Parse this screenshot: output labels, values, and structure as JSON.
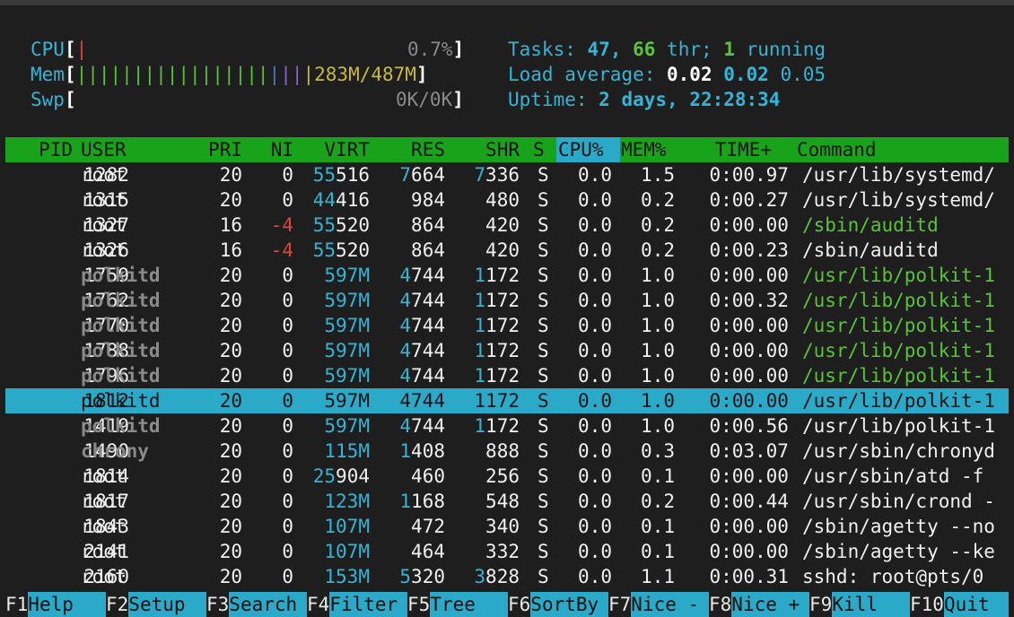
{
  "meters": {
    "cpu": {
      "label": "CPU",
      "bar": "|",
      "value": "0.7%"
    },
    "mem": {
      "label": "Mem",
      "bar_green": "|||||||||||||||||",
      "bar_blue": "|",
      "bar_purple": "||",
      "bar_yellow": "|",
      "value": "283M/487M"
    },
    "swp": {
      "label": "Swp",
      "value": "0K/0K"
    }
  },
  "summary": {
    "tasks_label": "Tasks: ",
    "tasks": "47",
    "sep1": ", ",
    "thr": "66",
    "thr_label": " thr; ",
    "running": "1",
    "running_label": " running",
    "load_label": "Load average: ",
    "load1": "0.02",
    "load5": "0.02",
    "load15": "0.05",
    "uptime_label": "Uptime: ",
    "uptime": "2 days, 22:28:34"
  },
  "columns": [
    "PID",
    "USER",
    "PRI",
    "NI",
    "VIRT",
    "RES",
    "SHR",
    "S",
    "CPU%",
    "MEM%",
    "TIME+",
    "Command"
  ],
  "processes": [
    {
      "pid": "1282",
      "user": "root",
      "pri": "20",
      "ni": "0",
      "virt_hi": "55",
      "virt_lo": "516",
      "res_hi": "7",
      "res_lo": "664",
      "shr_hi": "7",
      "shr_lo": "336",
      "s": "S",
      "cpu": "0.0",
      "mem": "1.5",
      "time": "0:00.97",
      "cmd": "/usr/lib/systemd/"
    },
    {
      "pid": "1315",
      "user": "root",
      "pri": "20",
      "ni": "0",
      "virt_hi": "44",
      "virt_lo": "416",
      "res_hi": "",
      "res_lo": "984",
      "shr_hi": "",
      "shr_lo": "480",
      "s": "S",
      "cpu": "0.0",
      "mem": "0.2",
      "time": "0:00.27",
      "cmd": "/usr/lib/systemd/"
    },
    {
      "pid": "1327",
      "user": "root",
      "pri": "16",
      "ni": "-4",
      "virt_hi": "55",
      "virt_lo": "520",
      "res_hi": "",
      "res_lo": "864",
      "shr_hi": "",
      "shr_lo": "420",
      "s": "S",
      "cpu": "0.0",
      "mem": "0.2",
      "time": "0:00.00",
      "cmd": "/sbin/auditd"
    },
    {
      "pid": "1326",
      "user": "root",
      "pri": "16",
      "ni": "-4",
      "virt_hi": "55",
      "virt_lo": "520",
      "res_hi": "",
      "res_lo": "864",
      "shr_hi": "",
      "shr_lo": "420",
      "s": "S",
      "cpu": "0.0",
      "mem": "0.2",
      "time": "0:00.23",
      "cmd": "/sbin/auditd"
    },
    {
      "pid": "1759",
      "user": "polkitd",
      "pri": "20",
      "ni": "0",
      "virt_hi": "",
      "virt_lo": "597M",
      "res_hi": "4",
      "res_lo": "744",
      "shr_hi": "1",
      "shr_lo": "172",
      "s": "S",
      "cpu": "0.0",
      "mem": "1.0",
      "time": "0:00.00",
      "cmd": "/usr/lib/polkit-1"
    },
    {
      "pid": "1762",
      "user": "polkitd",
      "pri": "20",
      "ni": "0",
      "virt_hi": "",
      "virt_lo": "597M",
      "res_hi": "4",
      "res_lo": "744",
      "shr_hi": "1",
      "shr_lo": "172",
      "s": "S",
      "cpu": "0.0",
      "mem": "1.0",
      "time": "0:00.32",
      "cmd": "/usr/lib/polkit-1"
    },
    {
      "pid": "1770",
      "user": "polkitd",
      "pri": "20",
      "ni": "0",
      "virt_hi": "",
      "virt_lo": "597M",
      "res_hi": "4",
      "res_lo": "744",
      "shr_hi": "1",
      "shr_lo": "172",
      "s": "S",
      "cpu": "0.0",
      "mem": "1.0",
      "time": "0:00.00",
      "cmd": "/usr/lib/polkit-1"
    },
    {
      "pid": "1788",
      "user": "polkitd",
      "pri": "20",
      "ni": "0",
      "virt_hi": "",
      "virt_lo": "597M",
      "res_hi": "4",
      "res_lo": "744",
      "shr_hi": "1",
      "shr_lo": "172",
      "s": "S",
      "cpu": "0.0",
      "mem": "1.0",
      "time": "0:00.00",
      "cmd": "/usr/lib/polkit-1"
    },
    {
      "pid": "1796",
      "user": "polkitd",
      "pri": "20",
      "ni": "0",
      "virt_hi": "",
      "virt_lo": "597M",
      "res_hi": "4",
      "res_lo": "744",
      "shr_hi": "1",
      "shr_lo": "172",
      "s": "S",
      "cpu": "0.0",
      "mem": "1.0",
      "time": "0:00.00",
      "cmd": "/usr/lib/polkit-1"
    },
    {
      "pid": "1812",
      "user": "polkitd",
      "pri": "20",
      "ni": "0",
      "virt_hi": "",
      "virt_lo": "597M",
      "res_hi": "",
      "res_lo": "4744",
      "shr_hi": "",
      "shr_lo": "1172",
      "s": "S",
      "cpu": "0.0",
      "mem": "1.0",
      "time": "0:00.00",
      "cmd": "/usr/lib/polkit-1",
      "selected": true
    },
    {
      "pid": "1419",
      "user": "polkitd",
      "pri": "20",
      "ni": "0",
      "virt_hi": "",
      "virt_lo": "597M",
      "res_hi": "4",
      "res_lo": "744",
      "shr_hi": "1",
      "shr_lo": "172",
      "s": "S",
      "cpu": "0.0",
      "mem": "1.0",
      "time": "0:00.56",
      "cmd": "/usr/lib/polkit-1"
    },
    {
      "pid": "1490",
      "user": "chrony",
      "pri": "20",
      "ni": "0",
      "virt_hi": "",
      "virt_lo": "115M",
      "res_hi": "1",
      "res_lo": "408",
      "shr_hi": "",
      "shr_lo": "888",
      "s": "S",
      "cpu": "0.0",
      "mem": "0.3",
      "time": "0:03.07",
      "cmd": "/usr/sbin/chronyd"
    },
    {
      "pid": "1814",
      "user": "root",
      "pri": "20",
      "ni": "0",
      "virt_hi": "25",
      "virt_lo": "904",
      "res_hi": "",
      "res_lo": "460",
      "shr_hi": "",
      "shr_lo": "256",
      "s": "S",
      "cpu": "0.0",
      "mem": "0.1",
      "time": "0:00.00",
      "cmd": "/usr/sbin/atd -f"
    },
    {
      "pid": "1817",
      "user": "root",
      "pri": "20",
      "ni": "0",
      "virt_hi": "",
      "virt_lo": "123M",
      "res_hi": "1",
      "res_lo": "168",
      "shr_hi": "",
      "shr_lo": "548",
      "s": "S",
      "cpu": "0.0",
      "mem": "0.2",
      "time": "0:00.44",
      "cmd": "/usr/sbin/crond -"
    },
    {
      "pid": "1843",
      "user": "root",
      "pri": "20",
      "ni": "0",
      "virt_hi": "",
      "virt_lo": "107M",
      "res_hi": "",
      "res_lo": "472",
      "shr_hi": "",
      "shr_lo": "340",
      "s": "S",
      "cpu": "0.0",
      "mem": "0.1",
      "time": "0:00.00",
      "cmd": "/sbin/agetty --no"
    },
    {
      "pid": "2141",
      "user": "root",
      "pri": "20",
      "ni": "0",
      "virt_hi": "",
      "virt_lo": "107M",
      "res_hi": "",
      "res_lo": "464",
      "shr_hi": "",
      "shr_lo": "332",
      "s": "S",
      "cpu": "0.0",
      "mem": "0.1",
      "time": "0:00.00",
      "cmd": "/sbin/agetty --ke"
    },
    {
      "pid": "2160",
      "user": "root",
      "pri": "20",
      "ni": "0",
      "virt_hi": "",
      "virt_lo": "153M",
      "res_hi": "5",
      "res_lo": "320",
      "shr_hi": "3",
      "shr_lo": "828",
      "s": "S",
      "cpu": "0.0",
      "mem": "1.1",
      "time": "0:00.31",
      "cmd": "sshd: root@pts/0"
    }
  ],
  "fkeys": [
    {
      "key": "F1",
      "label": "Help  "
    },
    {
      "key": "F2",
      "label": "Setup "
    },
    {
      "key": "F3",
      "label": "Search"
    },
    {
      "key": "F4",
      "label": "Filter"
    },
    {
      "key": "F5",
      "label": "Tree  "
    },
    {
      "key": "F6",
      "label": "SortBy"
    },
    {
      "key": "F7",
      "label": "Nice -"
    },
    {
      "key": "F8",
      "label": "Nice +"
    },
    {
      "key": "F9",
      "label": "Kill  "
    },
    {
      "key": "F10",
      "label": "Quit  "
    }
  ],
  "colors": {
    "header_bg": "#19a31b",
    "selection_bg": "#2aa9c9",
    "cyan": "#35b4d6",
    "green": "#5ac337"
  }
}
